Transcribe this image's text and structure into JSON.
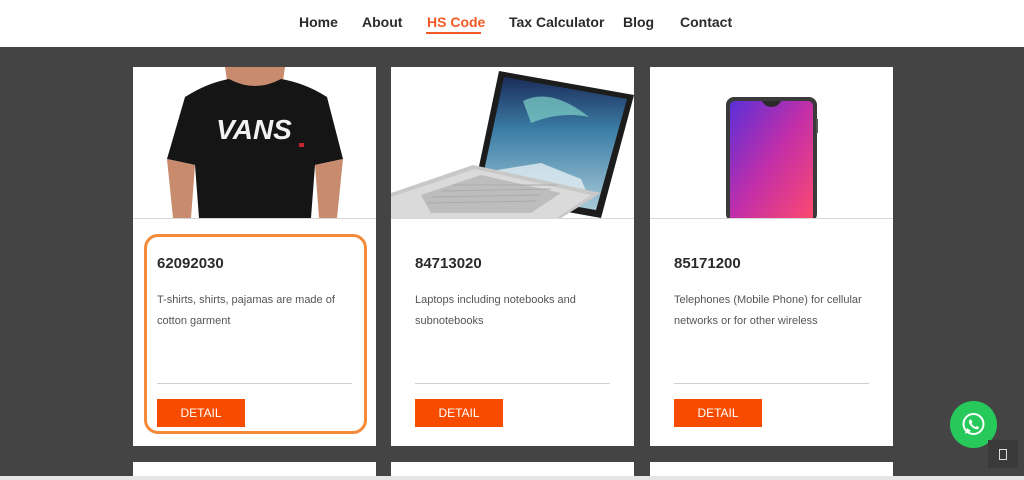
{
  "nav": {
    "items": [
      {
        "label": "Home"
      },
      {
        "label": "About"
      },
      {
        "label": "HS Code"
      },
      {
        "label": "Tax Calculator"
      },
      {
        "label": "Blog"
      },
      {
        "label": "Contact"
      }
    ],
    "active": "HS Code",
    "accent_color": "#f15a24"
  },
  "cards": [
    {
      "code": "62092030",
      "description": "T-shirts, shirts, pajamas are made of cotton garment",
      "button_label": "DETAIL",
      "image_text": "VANS",
      "image_icon": "tshirt-image"
    },
    {
      "code": "84713020",
      "description": "Laptops including notebooks and subnotebooks",
      "button_label": "DETAIL",
      "image_icon": "laptop-image"
    },
    {
      "code": "85171200",
      "description": "Telephones (Mobile Phone) for cellular networks or for other wireless",
      "button_label": "DETAIL",
      "image_icon": "mobile-phone-image"
    }
  ],
  "colors": {
    "button": "#f74b00",
    "highlight": "#f58a3a",
    "whatsapp": "#27c95b",
    "background": "#444444"
  },
  "floating": {
    "whatsapp_icon": "whatsapp-icon",
    "back_to_top_icon": "back-to-top-icon"
  }
}
